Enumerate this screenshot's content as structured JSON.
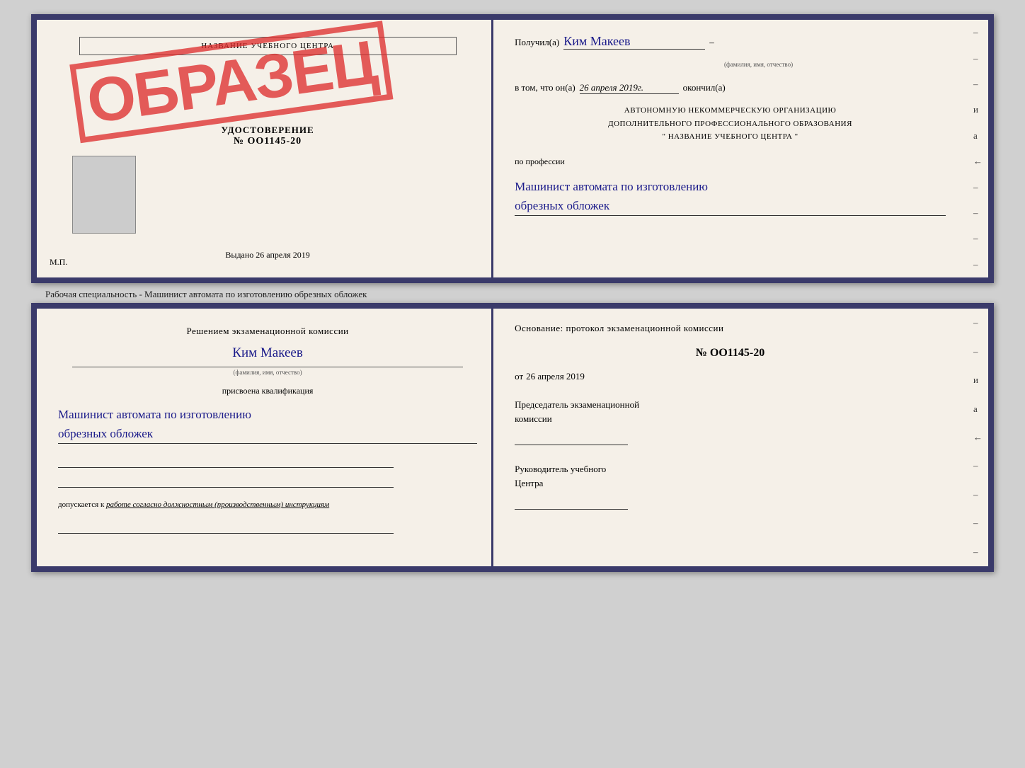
{
  "top_cert": {
    "left": {
      "school_title": "НАЗВАНИЕ УЧЕБНОГО ЦЕНТРА",
      "doc_type": "УДОСТОВЕРЕНИЕ",
      "doc_number": "№ OO1145-20",
      "issue_prefix": "Выдано",
      "issue_date": "26 апреля 2019",
      "mp_label": "М.П."
    },
    "stamp": "ОБРАЗЕЦ",
    "right": {
      "recipient_prefix": "Получил(а)",
      "recipient_name": "Ким Макеев",
      "recipient_subtitle": "(фамилия, имя, отчество)",
      "date_prefix": "в том, что он(а)",
      "date_value": "26 апреля 2019г.",
      "date_suffix": "окончил(а)",
      "org_line1": "АВТОНОМНУЮ НЕКОММЕРЧЕСКУЮ ОРГАНИЗАЦИЮ",
      "org_line2": "ДОПОЛНИТЕЛЬНОГО ПРОФЕССИОНАЛЬНОГО ОБРАЗОВАНИЯ",
      "org_line3": "\"   НАЗВАНИЕ УЧЕБНОГО ЦЕНТРА   \"",
      "profession_label": "по профессии",
      "profession_line1": "Машинист автомата по изготовлению",
      "profession_line2": "обрезных обложек",
      "side_dashes": [
        "–",
        "–",
        "–",
        "и",
        "а",
        "←",
        "–",
        "–",
        "–",
        "–"
      ]
    }
  },
  "middle_label": "Рабочая специальность - Машинист автомата по изготовлению обрезных обложек",
  "bottom_cert": {
    "left": {
      "commission_prefix": "Решением экзаменационной комиссии",
      "commission_name": "Ким Макеев",
      "fio_subtitle": "(фамилия, имя, отчество)",
      "kvali_label": "присвоена квалификация",
      "kvali_line1": "Машинист автомата по изготовлению",
      "kvali_line2": "обрезных обложек",
      "dopusk_prefix": "допускается к",
      "dopusk_text": "работе согласно должностным (производственным) инструкциям"
    },
    "right": {
      "osnov_text": "Основание: протокол экзаменационной комиссии",
      "protocol_number": "№ OO1145-20",
      "protocol_date_prefix": "от",
      "protocol_date": "26 апреля 2019",
      "chairman_label": "Председатель экзаменационной",
      "chairman_label2": "комиссии",
      "rukov_label": "Руководитель учебного",
      "rukov_label2": "Центра",
      "side_dashes": [
        "–",
        "–",
        "и",
        "а",
        "←",
        "–",
        "–",
        "–",
        "–"
      ]
    }
  }
}
